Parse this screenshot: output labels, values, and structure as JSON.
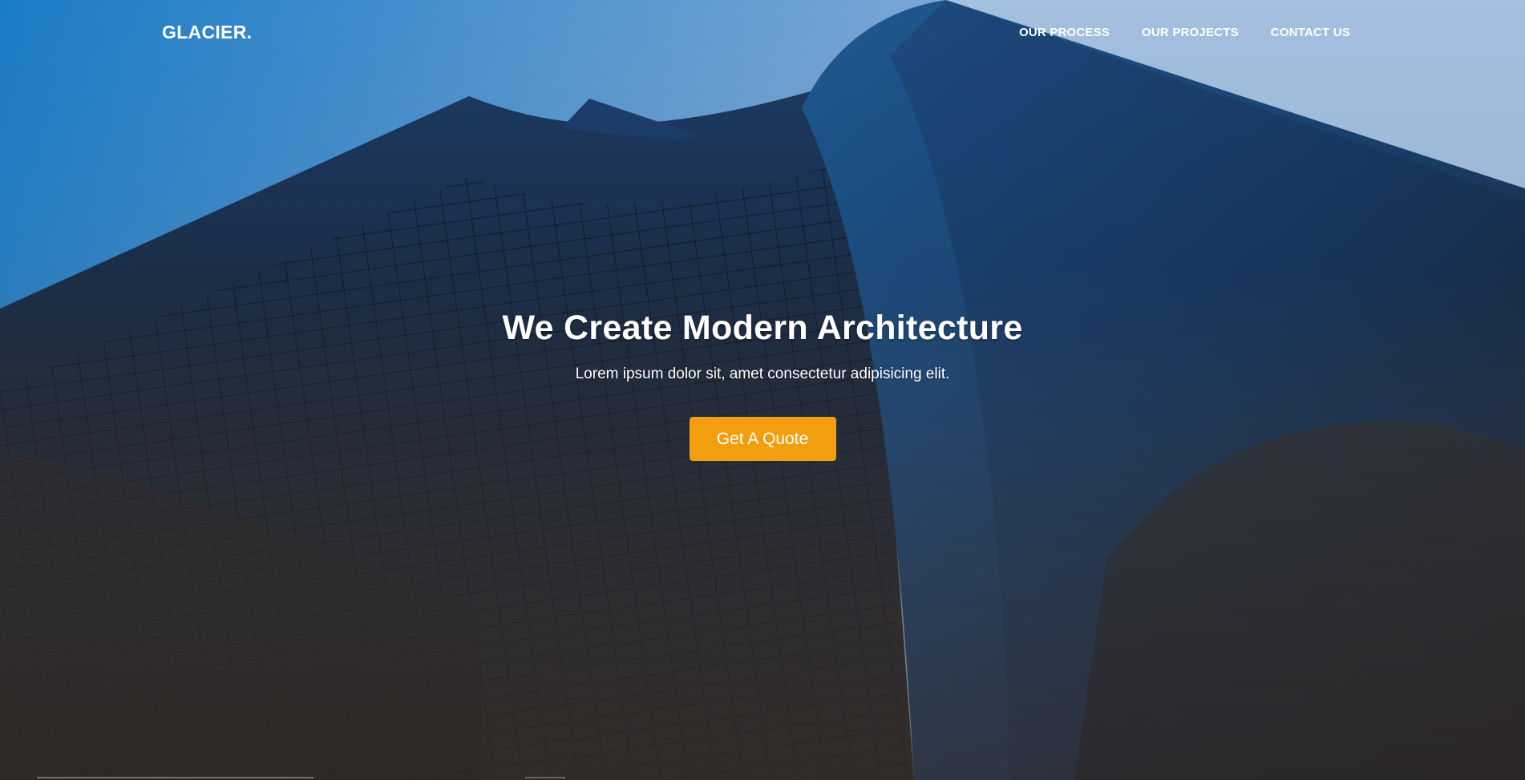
{
  "brand": {
    "logo_text": "GLACIER."
  },
  "nav": {
    "items": [
      {
        "label": "OUR PROCESS"
      },
      {
        "label": "OUR PROJECTS"
      },
      {
        "label": "CONTACT US"
      }
    ]
  },
  "hero": {
    "title": "We Create Modern Architecture",
    "subtitle": "Lorem ipsum dolor sit, amet consectetur adipisicing elit.",
    "cta_label": "Get A Quote"
  },
  "colors": {
    "accent": "#f29e0e",
    "sky_top": "#1e7fc4",
    "sky_light": "#a9c3e0",
    "building_dark": "#1b2536",
    "building_blue": "#1e4a7a",
    "text": "#ffffff"
  }
}
